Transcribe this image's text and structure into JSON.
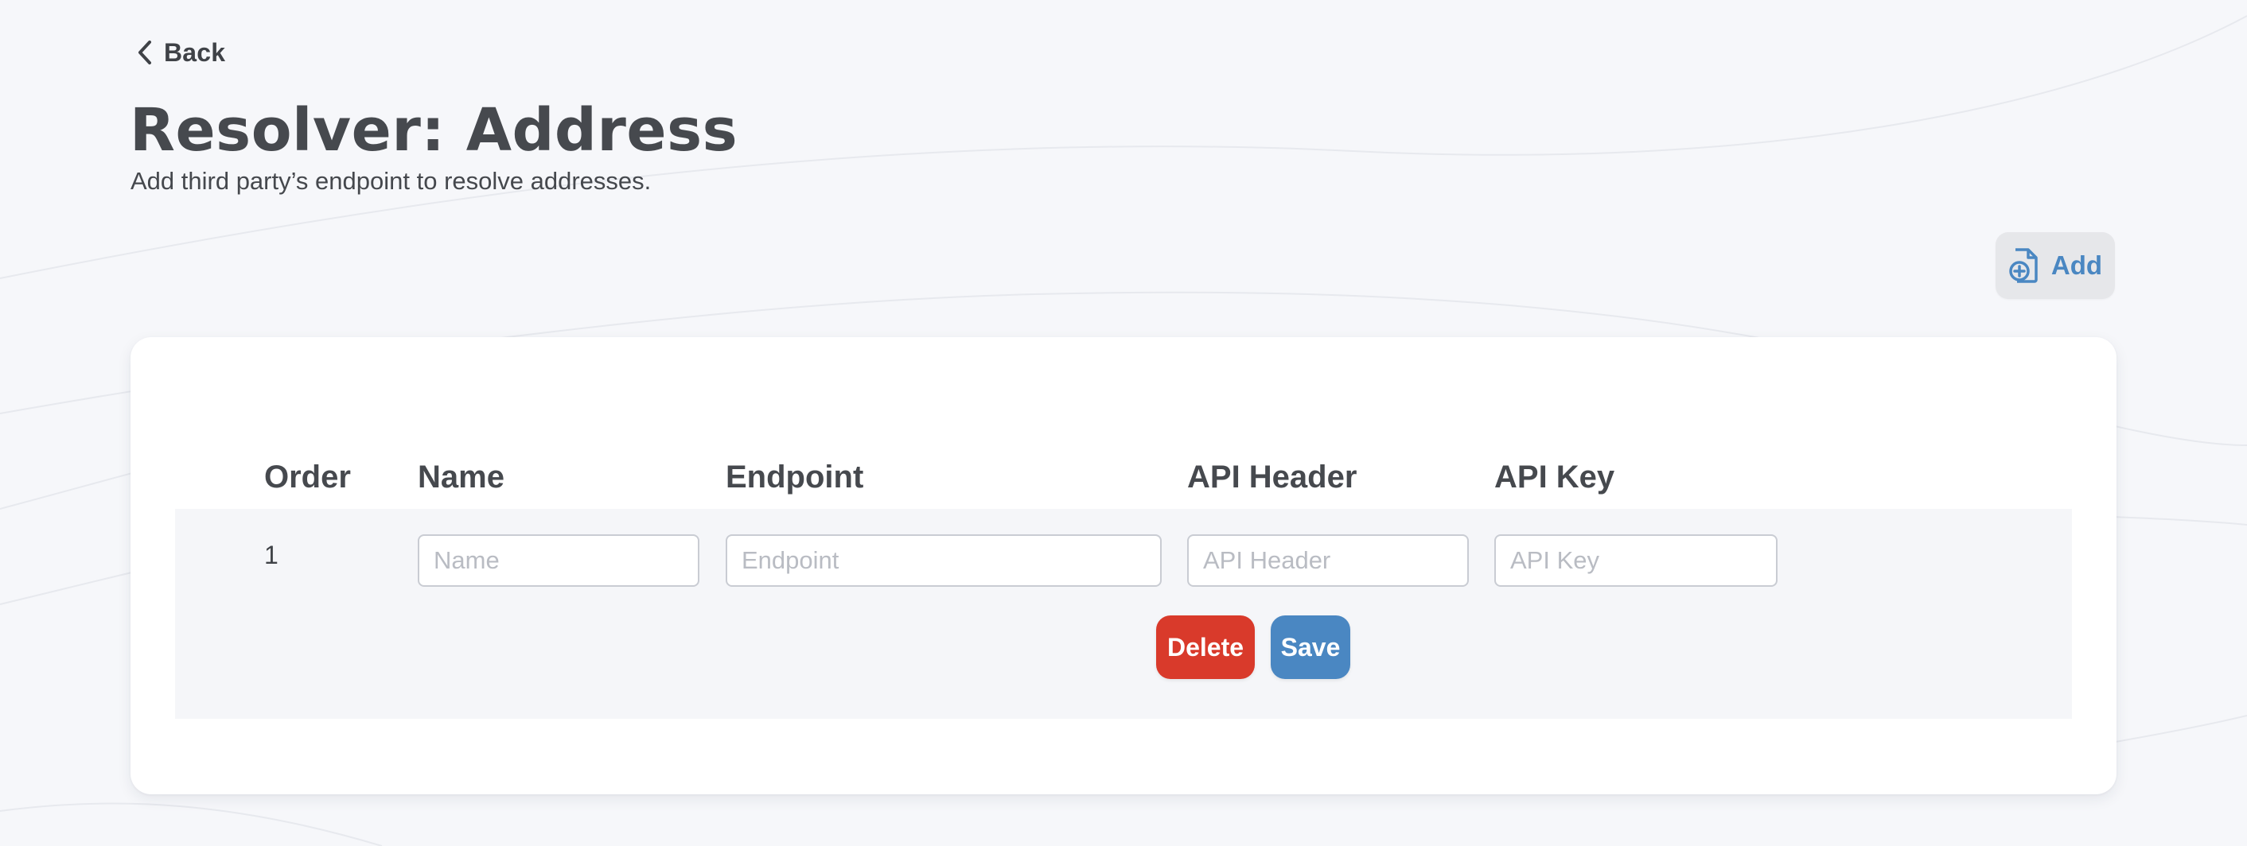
{
  "nav": {
    "back_label": "Back",
    "back_icon": "chevron-left-icon"
  },
  "header": {
    "title": "Resolver: Address",
    "subtitle": "Add third party’s endpoint to resolve addresses."
  },
  "toolbar": {
    "add_label": "Add",
    "add_icon": "document-add-icon"
  },
  "table": {
    "columns": [
      "Order",
      "Name",
      "Endpoint",
      "API Header",
      "API Key"
    ],
    "rows": [
      {
        "order": "1",
        "name": {
          "value": "",
          "placeholder": "Name"
        },
        "endpoint": {
          "value": "",
          "placeholder": "Endpoint"
        },
        "api_header": {
          "value": "",
          "placeholder": "API Header"
        },
        "api_key": {
          "value": "",
          "placeholder": "API Key"
        },
        "delete_label": "Delete",
        "save_label": "Save"
      }
    ]
  },
  "colors": {
    "background": "#f6f7fa",
    "text": "#3f4247",
    "accent": "#4a87c2",
    "danger": "#d93a2b",
    "card": "#ffffff",
    "row": "#f5f6f9",
    "add_button_bg": "#e6e7ea"
  }
}
